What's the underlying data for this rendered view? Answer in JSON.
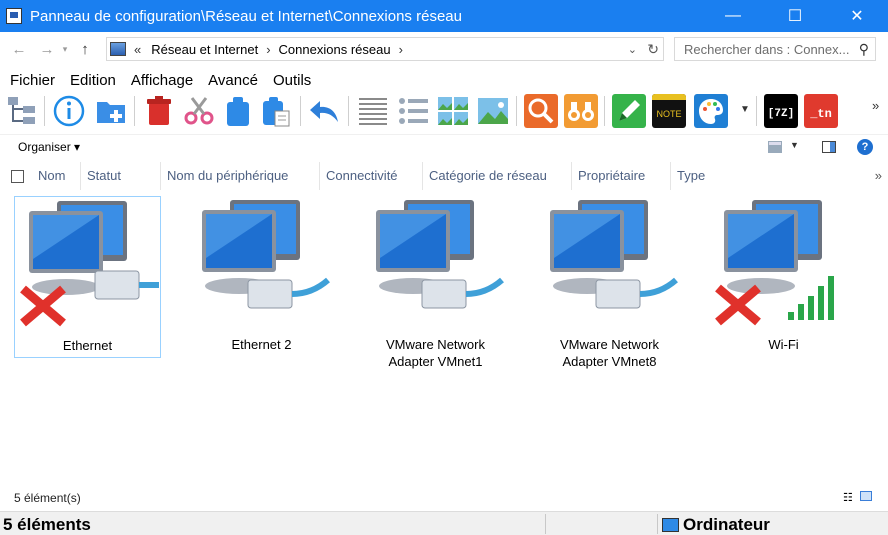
{
  "titlebar": {
    "title": "Panneau de configuration\\Réseau et Internet\\Connexions réseau",
    "minimize": "—",
    "maximize": "☐",
    "close": "✕"
  },
  "address": {
    "prefix": "«",
    "crumbs": [
      "Réseau et Internet",
      "Connexions réseau"
    ],
    "separator": "›"
  },
  "search": {
    "placeholder": "Rechercher dans : Connex..."
  },
  "menu": [
    "Fichier",
    "Edition",
    "Affichage",
    "Avancé",
    "Outils"
  ],
  "cmdbar": {
    "organize": "Organiser ▾"
  },
  "columns": [
    "Nom",
    "Statut",
    "Nom du périphérique",
    "Connectivité",
    "Catégorie de réseau",
    "Propriétaire",
    "Type"
  ],
  "items": [
    {
      "label": "Ethernet",
      "state": "disconnected",
      "kind": "wired",
      "selected": true
    },
    {
      "label": "Ethernet 2",
      "state": "connected",
      "kind": "wired",
      "selected": false
    },
    {
      "label": "VMware Network Adapter VMnet1",
      "state": "connected",
      "kind": "wired",
      "selected": false
    },
    {
      "label": "VMware Network Adapter VMnet8",
      "state": "connected",
      "kind": "wired",
      "selected": false
    },
    {
      "label": "Wi-Fi",
      "state": "disconnected",
      "kind": "wireless",
      "selected": false
    }
  ],
  "status": {
    "count_small": "5 élément(s)",
    "count_big": "5 éléments",
    "location": "Ordinateur"
  },
  "colors": {
    "titlebar": "#1a7ff0",
    "accent_blue": "#1e6fd0",
    "error_red": "#e0312b",
    "signal_green": "#2aa64a"
  }
}
